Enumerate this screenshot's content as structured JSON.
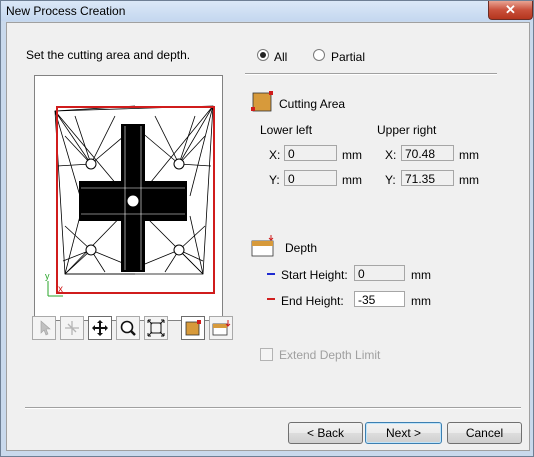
{
  "window": {
    "title": "New Process Creation",
    "close_glyph": "✕"
  },
  "left": {
    "instruction": "Set the cutting area and depth."
  },
  "scope": {
    "all_label": "All",
    "partial_label": "Partial",
    "selected": "All"
  },
  "cutting_area": {
    "title": "Cutting Area",
    "lower_left_label": "Lower left",
    "upper_right_label": "Upper right",
    "ll_x_label": "X:",
    "ll_x_value": "0",
    "ll_x_unit": "mm",
    "ll_y_label": "Y:",
    "ll_y_value": "0",
    "ll_y_unit": "mm",
    "ur_x_label": "X:",
    "ur_x_value": "70.48",
    "ur_x_unit": "mm",
    "ur_y_label": "Y:",
    "ur_y_value": "71.35",
    "ur_y_unit": "mm"
  },
  "depth": {
    "title": "Depth",
    "start_label": "Start Height:",
    "start_value": "0",
    "start_unit": "mm",
    "end_label": "End Height:",
    "end_value": "-35",
    "end_unit": "mm"
  },
  "extend_depth_limit": {
    "label": "Extend Depth Limit",
    "checked": false
  },
  "preview_axes": {
    "x_label": "x",
    "y_label": "y"
  },
  "buttons": {
    "back": "< Back",
    "next": "Next >",
    "cancel": "Cancel"
  },
  "toolbar": [
    "select-arrow-icon",
    "rotate-view-icon",
    "pan-move-icon",
    "zoom-magnifier-icon",
    "fit-view-icon",
    "cutting-area-icon",
    "depth-icon"
  ],
  "colors": {
    "start_line": "#1f2bd1",
    "end_line": "#d11f1f",
    "cutting_rect": "#d01c1c",
    "area_fill": "#d79a3b"
  }
}
